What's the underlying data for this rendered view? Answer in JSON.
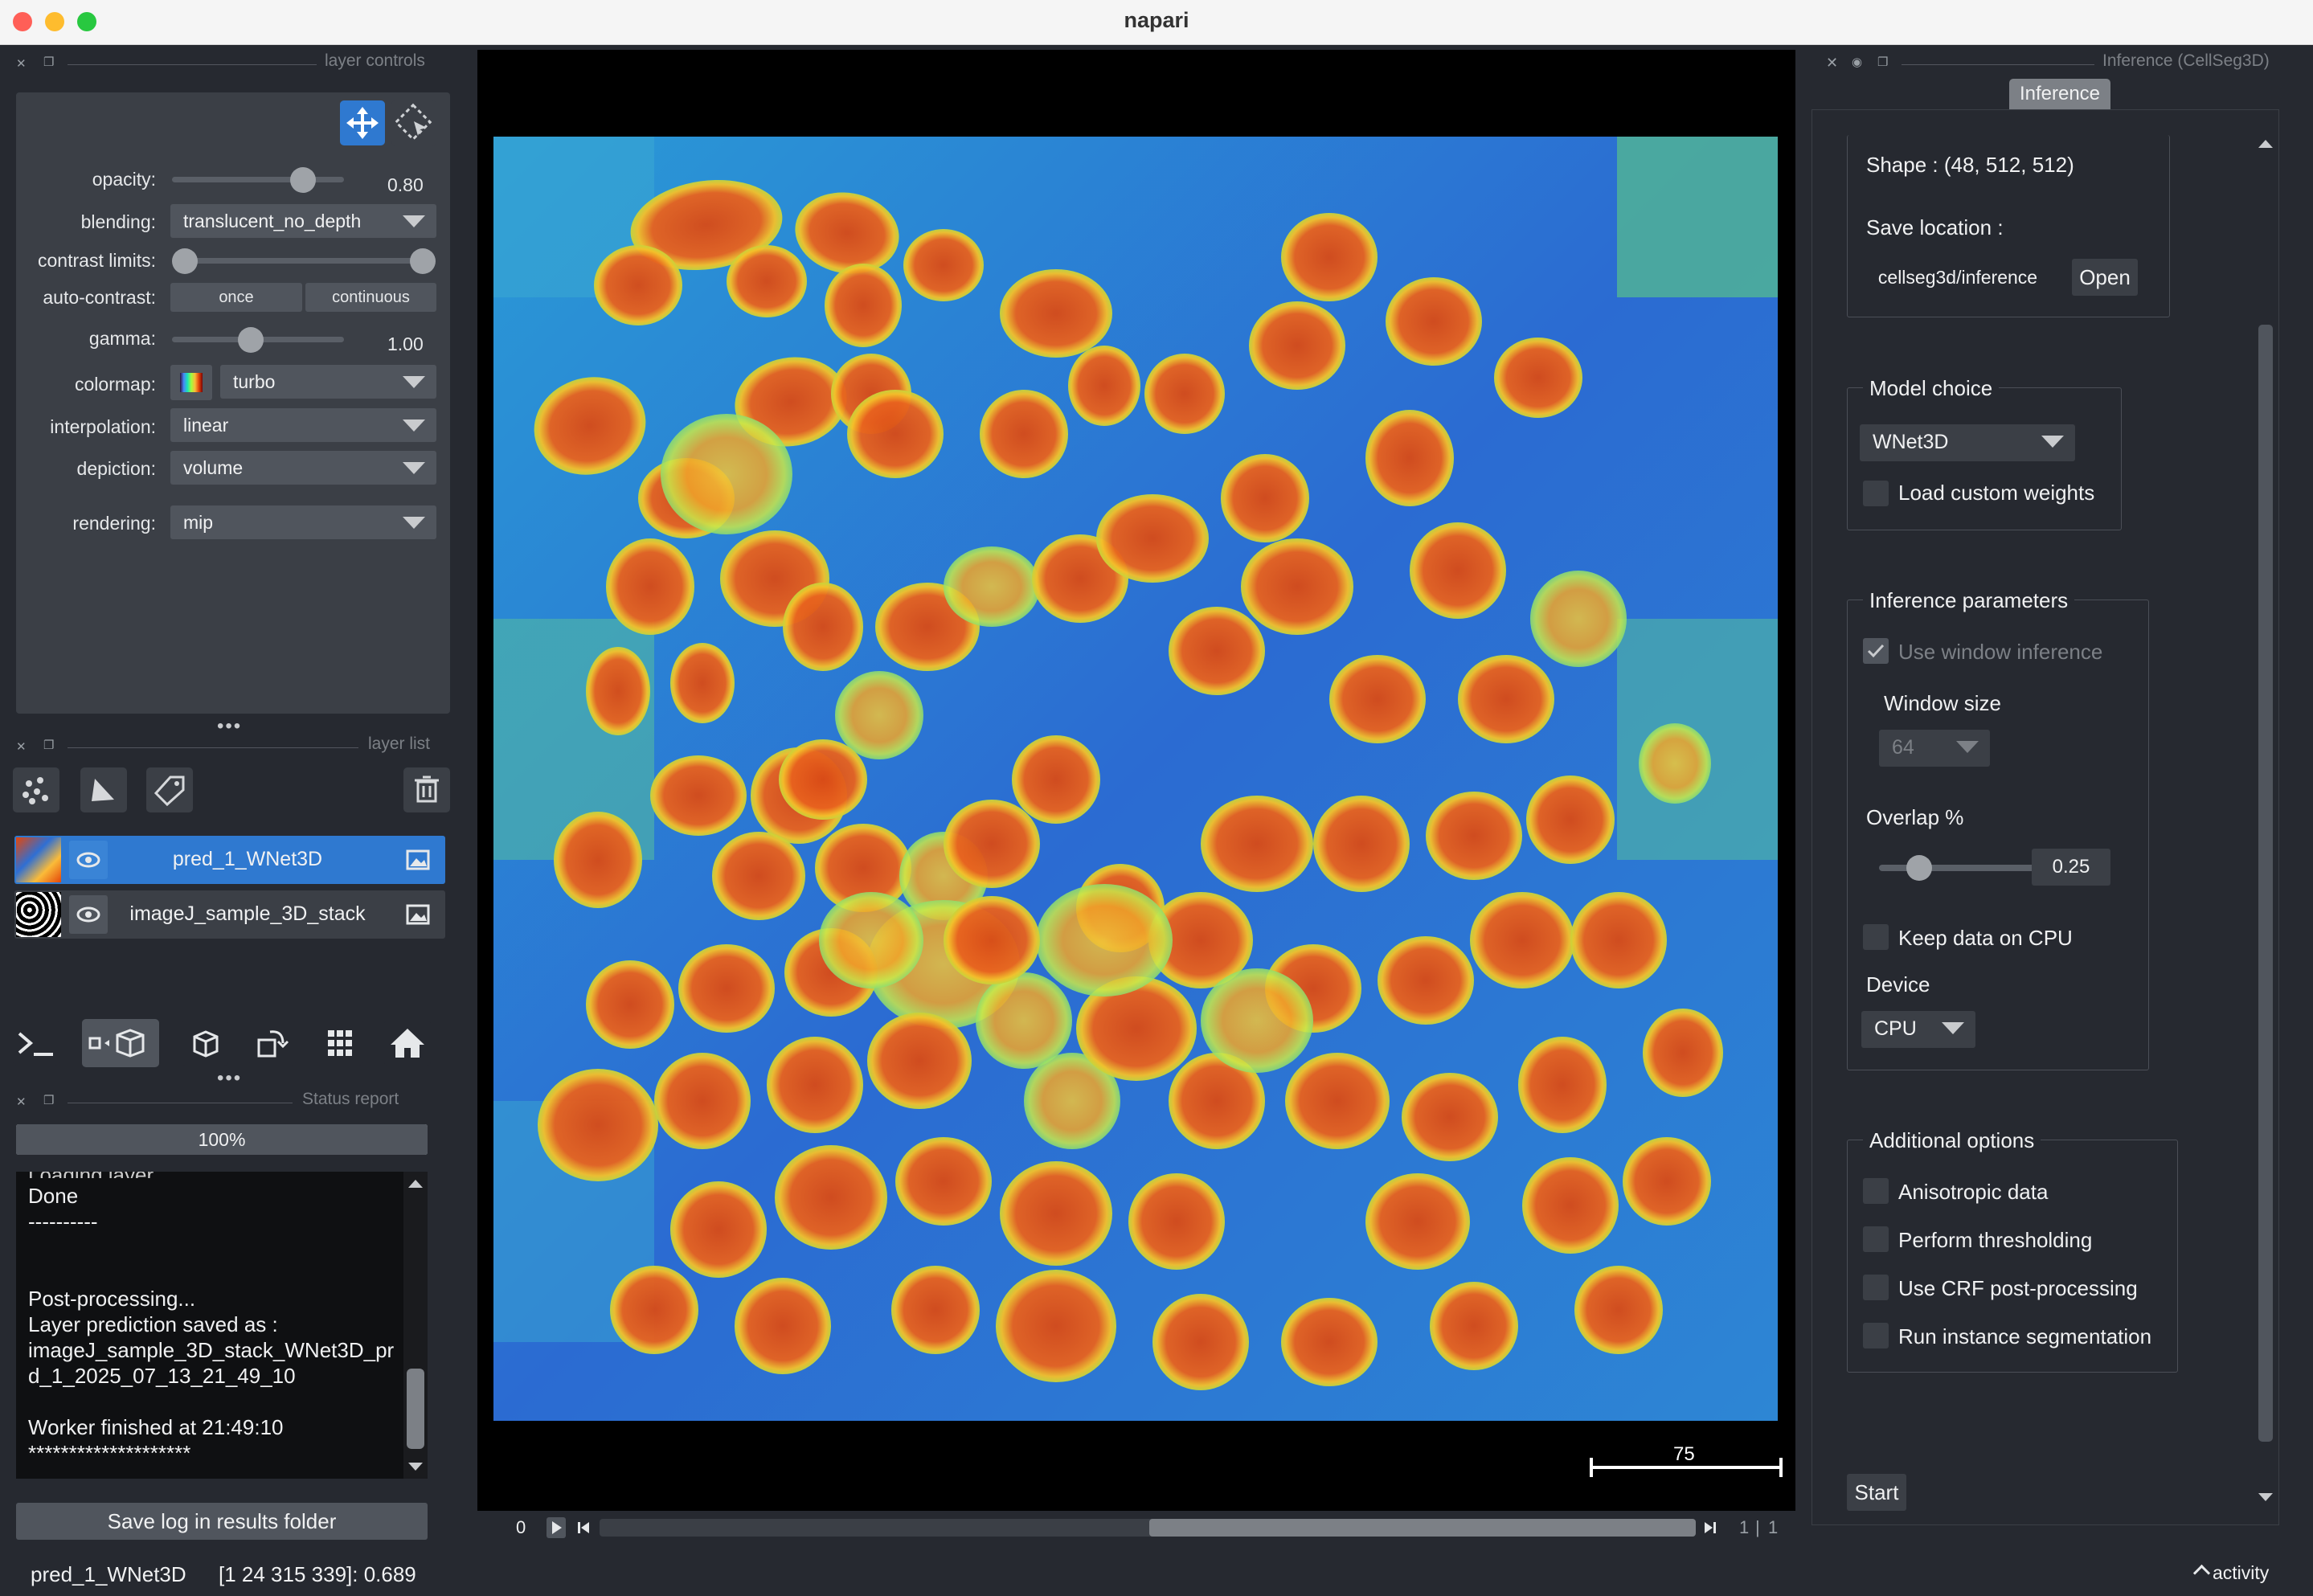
{
  "window": {
    "title": "napari"
  },
  "layer_controls": {
    "title": "layer controls",
    "opacity": {
      "label": "opacity:",
      "value": "0.80",
      "level": 0.8
    },
    "blending": {
      "label": "blending:",
      "value": "translucent_no_depth"
    },
    "contrast_limits": {
      "label": "contrast limits:"
    },
    "auto_contrast": {
      "label": "auto-contrast:",
      "once": "once",
      "continuous": "continuous"
    },
    "gamma": {
      "label": "gamma:",
      "value": "1.00"
    },
    "colormap": {
      "label": "colormap:",
      "value": "turbo"
    },
    "interpolation": {
      "label": "interpolation:",
      "value": "linear"
    },
    "depiction": {
      "label": "depiction:",
      "value": "volume"
    },
    "rendering": {
      "label": "rendering:",
      "value": "mip"
    }
  },
  "layer_list": {
    "title": "layer list",
    "layers": [
      {
        "name": "pred_1_WNet3D",
        "selected": true
      },
      {
        "name": "imageJ_sample_3D_stack",
        "selected": false
      }
    ]
  },
  "status_report": {
    "title": "Status report",
    "progress": "100%",
    "log_lines": [
      "Done",
      "----------",
      "",
      "",
      "Post-processing...",
      "Layer prediction saved as :",
      "imageJ_sample_3D_stack_WNet3D_pr",
      "d_1_2025_07_13_21_49_10",
      "",
      "Worker finished at 21:49:10",
      "********************"
    ],
    "save_button": "Save log in results folder"
  },
  "status_bar": {
    "layer": "pred_1_WNet3D",
    "coords": "[1 24 315 339]: 0.689",
    "activity": "activity"
  },
  "viewer": {
    "scale_bar": "75",
    "dims": {
      "current": "0",
      "frame": "1",
      "total": "1"
    }
  },
  "plugin": {
    "title": "Inference (CellSeg3D)",
    "tab": "Inference",
    "shape": "Shape : (48, 512, 512)",
    "save_location_label": "Save location :",
    "save_location_value": "cellseg3d/inference",
    "open_button": "Open",
    "model_choice": {
      "title": "Model choice",
      "value": "WNet3D",
      "custom_weights": "Load custom weights"
    },
    "inference_params": {
      "title": "Inference parameters",
      "use_window": "Use window inference",
      "window_size_label": "Window size",
      "window_size": "64",
      "overlap_label": "Overlap %",
      "overlap": "0.25",
      "keep_cpu": "Keep data on CPU",
      "device_label": "Device",
      "device": "CPU"
    },
    "additional": {
      "title": "Additional options",
      "options": [
        "Anisotropic data",
        "Perform thresholding",
        "Use CRF post-processing",
        "Run instance segmentation"
      ]
    },
    "start_button": "Start"
  },
  "colors": {
    "accent": "#2f79d0",
    "panel": "#3b3f46",
    "background": "#262930"
  },
  "icons": [
    "pan-zoom-icon",
    "transform-icon",
    "points-icon",
    "shapes-icon",
    "labels-icon",
    "delete-icon",
    "eye-icon",
    "image-icon",
    "console-icon",
    "ndisplay-icon",
    "roll-icon",
    "transpose-icon",
    "grid-icon",
    "home-icon",
    "play-icon",
    "close-icon",
    "float-icon"
  ]
}
